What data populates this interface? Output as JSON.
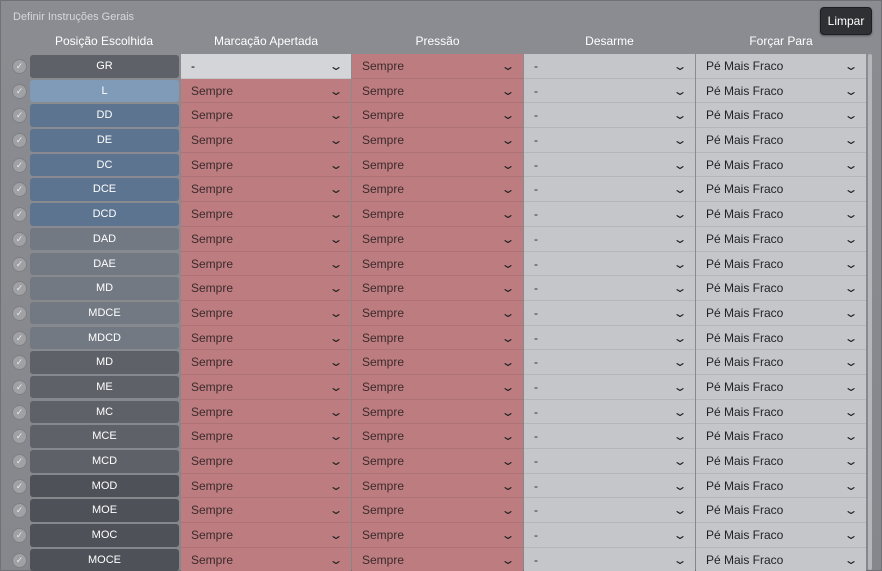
{
  "panel": {
    "title": "Definir Instruções Gerais",
    "clear_label": "Limpar"
  },
  "columns": {
    "position": "Posição Escolhida",
    "marking": "Marcação Apertada",
    "pressing": "Pressão",
    "disarm": "Desarme",
    "force": "Forçar Para"
  },
  "check_symbol": "✓",
  "dropdown_symbol": "⌄",
  "colors": {
    "position_light_blue": "#7f9bb8",
    "position_blue": "#5d7490",
    "position_slate": "#737983",
    "position_dark": "#5e6168",
    "position_darkest": "#4e5157",
    "red_cell": "#bd7d80",
    "grey_cell": "#c4c6ca"
  },
  "rows": [
    {
      "pos": "GR",
      "shade": "position_dark",
      "marking": "-",
      "marking_style": "sel",
      "pressing": "Sempre",
      "disarm": "-",
      "force": "Pé Mais Fraco"
    },
    {
      "pos": "L",
      "shade": "position_light_blue",
      "marking": "Sempre",
      "marking_style": "red",
      "pressing": "Sempre",
      "disarm": "-",
      "force": "Pé Mais Fraco"
    },
    {
      "pos": "DD",
      "shade": "position_blue",
      "marking": "Sempre",
      "marking_style": "red",
      "pressing": "Sempre",
      "disarm": "-",
      "force": "Pé Mais Fraco"
    },
    {
      "pos": "DE",
      "shade": "position_blue",
      "marking": "Sempre",
      "marking_style": "red",
      "pressing": "Sempre",
      "disarm": "-",
      "force": "Pé Mais Fraco"
    },
    {
      "pos": "DC",
      "shade": "position_blue",
      "marking": "Sempre",
      "marking_style": "red",
      "pressing": "Sempre",
      "disarm": "-",
      "force": "Pé Mais Fraco"
    },
    {
      "pos": "DCE",
      "shade": "position_blue",
      "marking": "Sempre",
      "marking_style": "red",
      "pressing": "Sempre",
      "disarm": "-",
      "force": "Pé Mais Fraco"
    },
    {
      "pos": "DCD",
      "shade": "position_blue",
      "marking": "Sempre",
      "marking_style": "red",
      "pressing": "Sempre",
      "disarm": "-",
      "force": "Pé Mais Fraco"
    },
    {
      "pos": "DAD",
      "shade": "position_slate",
      "marking": "Sempre",
      "marking_style": "red",
      "pressing": "Sempre",
      "disarm": "-",
      "force": "Pé Mais Fraco"
    },
    {
      "pos": "DAE",
      "shade": "position_slate",
      "marking": "Sempre",
      "marking_style": "red",
      "pressing": "Sempre",
      "disarm": "-",
      "force": "Pé Mais Fraco"
    },
    {
      "pos": "MD",
      "shade": "position_slate",
      "marking": "Sempre",
      "marking_style": "red",
      "pressing": "Sempre",
      "disarm": "-",
      "force": "Pé Mais Fraco"
    },
    {
      "pos": "MDCE",
      "shade": "position_slate",
      "marking": "Sempre",
      "marking_style": "red",
      "pressing": "Sempre",
      "disarm": "-",
      "force": "Pé Mais Fraco"
    },
    {
      "pos": "MDCD",
      "shade": "position_slate",
      "marking": "Sempre",
      "marking_style": "red",
      "pressing": "Sempre",
      "disarm": "-",
      "force": "Pé Mais Fraco"
    },
    {
      "pos": "MD",
      "shade": "position_dark",
      "marking": "Sempre",
      "marking_style": "red",
      "pressing": "Sempre",
      "disarm": "-",
      "force": "Pé Mais Fraco"
    },
    {
      "pos": "ME",
      "shade": "position_dark",
      "marking": "Sempre",
      "marking_style": "red",
      "pressing": "Sempre",
      "disarm": "-",
      "force": "Pé Mais Fraco"
    },
    {
      "pos": "MC",
      "shade": "position_dark",
      "marking": "Sempre",
      "marking_style": "red",
      "pressing": "Sempre",
      "disarm": "-",
      "force": "Pé Mais Fraco"
    },
    {
      "pos": "MCE",
      "shade": "position_dark",
      "marking": "Sempre",
      "marking_style": "red",
      "pressing": "Sempre",
      "disarm": "-",
      "force": "Pé Mais Fraco"
    },
    {
      "pos": "MCD",
      "shade": "position_dark",
      "marking": "Sempre",
      "marking_style": "red",
      "pressing": "Sempre",
      "disarm": "-",
      "force": "Pé Mais Fraco"
    },
    {
      "pos": "MOD",
      "shade": "position_darkest",
      "marking": "Sempre",
      "marking_style": "red",
      "pressing": "Sempre",
      "disarm": "-",
      "force": "Pé Mais Fraco"
    },
    {
      "pos": "MOE",
      "shade": "position_darkest",
      "marking": "Sempre",
      "marking_style": "red",
      "pressing": "Sempre",
      "disarm": "-",
      "force": "Pé Mais Fraco"
    },
    {
      "pos": "MOC",
      "shade": "position_darkest",
      "marking": "Sempre",
      "marking_style": "red",
      "pressing": "Sempre",
      "disarm": "-",
      "force": "Pé Mais Fraco"
    },
    {
      "pos": "MOCE",
      "shade": "position_darkest",
      "marking": "Sempre",
      "marking_style": "red",
      "pressing": "Sempre",
      "disarm": "-",
      "force": "Pé Mais Fraco"
    }
  ]
}
